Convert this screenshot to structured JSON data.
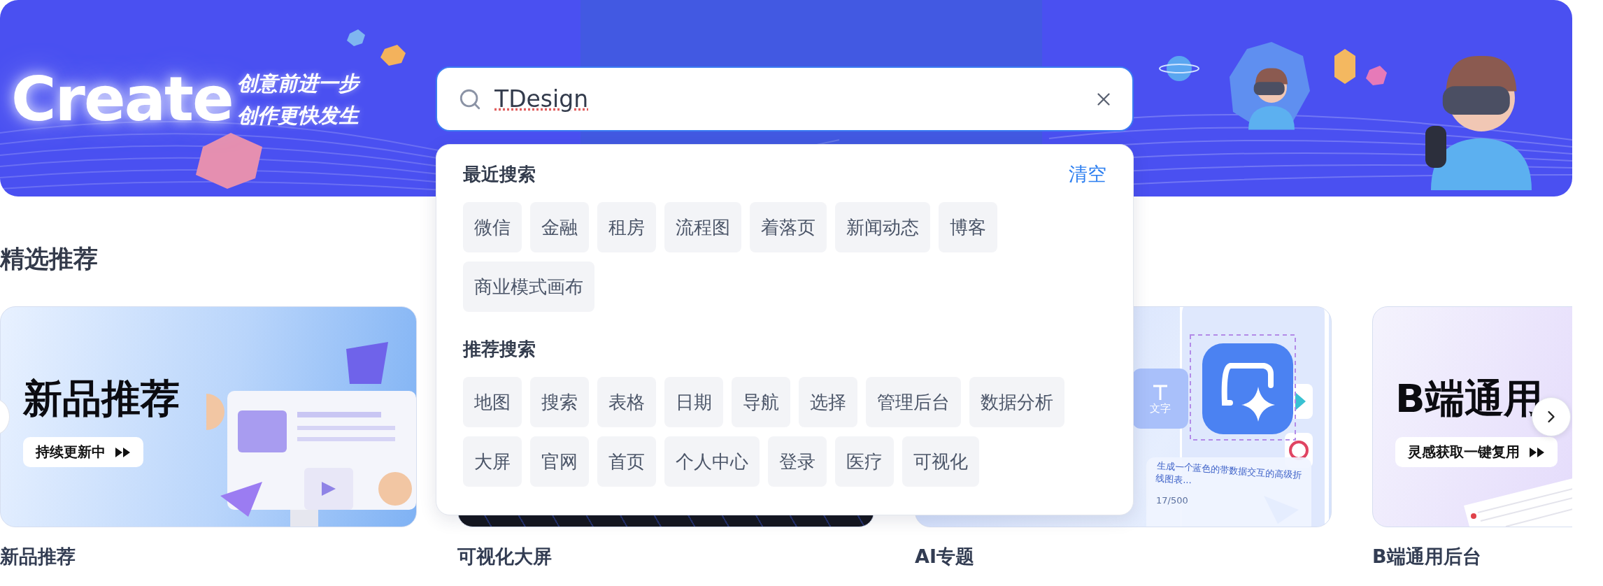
{
  "banner": {
    "title": "Create",
    "slogans": [
      "创意前进一步",
      "创作更快发生"
    ]
  },
  "search": {
    "value": "TDesign"
  },
  "dropdown": {
    "sections": [
      {
        "title": "最近搜索",
        "action": "清空",
        "tags": [
          "微信",
          "金融",
          "租房",
          "流程图",
          "着落页",
          "新闻动态",
          "博客",
          "商业模式画布"
        ]
      },
      {
        "title": "推荐搜索",
        "tags": [
          "地图",
          "搜索",
          "表格",
          "日期",
          "导航",
          "选择",
          "管理后台",
          "数据分析",
          "大屏",
          "官网",
          "首页",
          "个人中心",
          "登录",
          "医疗",
          "可视化"
        ]
      }
    ]
  },
  "featured": {
    "title": "精选推荐",
    "cards": [
      {
        "kind": "promo",
        "headline": "新品推荐",
        "pill": "持续更新中",
        "caption": "新品推荐"
      },
      {
        "kind": "screen",
        "caption": "可视化大屏"
      },
      {
        "kind": "ai",
        "tile": "文字",
        "prompt": "生成一个蓝色的带数据交互的高级折线图表...",
        "counter": "17/500",
        "caption": "AI专题"
      },
      {
        "kind": "backend",
        "headline": "B端通用",
        "pill": "灵感获取一键复用",
        "caption": "B端通用后台"
      }
    ]
  }
}
